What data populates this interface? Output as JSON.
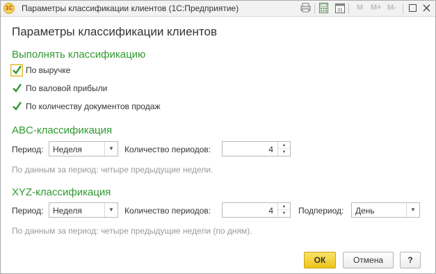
{
  "window": {
    "title": "Параметры классификации клиентов  (1С:Предприятие)",
    "logo_text": "1С",
    "memory_buttons": [
      "M",
      "M+",
      "M-"
    ]
  },
  "form": {
    "title": "Параметры классификации клиентов"
  },
  "perform": {
    "group_title": "Выполнять классификацию",
    "options": [
      {
        "label": "По выручке",
        "checked": true
      },
      {
        "label": "По валовой прибыли",
        "checked": true
      },
      {
        "label": "По количеству документов продаж",
        "checked": true
      }
    ]
  },
  "abc": {
    "group_title": "ABC-классификация",
    "period_label": "Период:",
    "period_value": "Неделя",
    "count_label": "Количество периодов:",
    "count_value": "4",
    "hint": "По данным за период: четыре предыдущие недели."
  },
  "xyz": {
    "group_title": "XYZ-классификация",
    "period_label": "Период:",
    "period_value": "Неделя",
    "count_label": "Количество периодов:",
    "count_value": "4",
    "subperiod_label": "Подпериод:",
    "subperiod_value": "День",
    "hint": "По данным за период: четыре предыдущие недели (по дням)."
  },
  "footer": {
    "ok_label": "ОК",
    "cancel_label": "Отмена",
    "help_label": "?"
  },
  "colors": {
    "group_title": "#2f9a2f",
    "primary_button": "#eec41a",
    "check_mark": "#2f9a2f"
  }
}
